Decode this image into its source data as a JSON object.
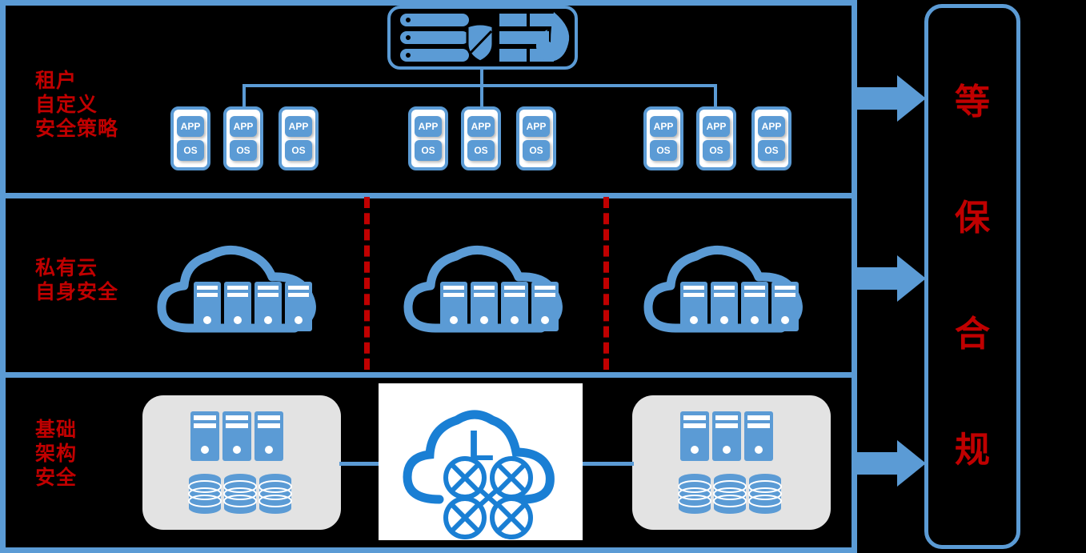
{
  "colors": {
    "background": "#000000",
    "accent_blue": "#5b9bd5",
    "accent_blue_dark": "#1a7fd4",
    "label_red": "#c00000",
    "gray_box": "#e3e3e3",
    "white": "#ffffff"
  },
  "bands": [
    {
      "id": "tenant",
      "label": "租户\n自定义\n安全策略"
    },
    {
      "id": "private",
      "label": "私有云\n自身安全"
    },
    {
      "id": "infra",
      "label": "基础\n架构\n安全"
    }
  ],
  "firewall": {
    "name": "firewall-appliance-icon",
    "parts": [
      "server-bars",
      "shield",
      "brick-wall",
      "flame"
    ]
  },
  "vm": {
    "app_label": "APP",
    "os_label": "OS"
  },
  "vm_groups": [
    {
      "id": "group-1",
      "vms": [
        "APP/OS",
        "APP/OS",
        "APP/OS"
      ]
    },
    {
      "id": "group-2",
      "vms": [
        "APP/OS",
        "APP/OS",
        "APP/OS"
      ]
    },
    {
      "id": "group-3",
      "vms": [
        "APP/OS",
        "APP/OS",
        "APP/OS"
      ]
    }
  ],
  "private_cloud": {
    "clouds": [
      {
        "id": "cloud-1",
        "server_count": 4
      },
      {
        "id": "cloud-2",
        "server_count": 4
      },
      {
        "id": "cloud-3",
        "server_count": 4
      }
    ],
    "separator_count": 2
  },
  "infrastructure": {
    "left_box": {
      "id": "infra-box-left",
      "server_count": 3,
      "database_count": 3
    },
    "right_box": {
      "id": "infra-box-right",
      "server_count": 3,
      "database_count": 3
    },
    "center": {
      "id": "sdn-cloud-icon",
      "letter": "L",
      "node_count": 4
    }
  },
  "compliance": {
    "characters": [
      "等",
      "保",
      "合",
      "规"
    ],
    "arrow_count": 3
  }
}
